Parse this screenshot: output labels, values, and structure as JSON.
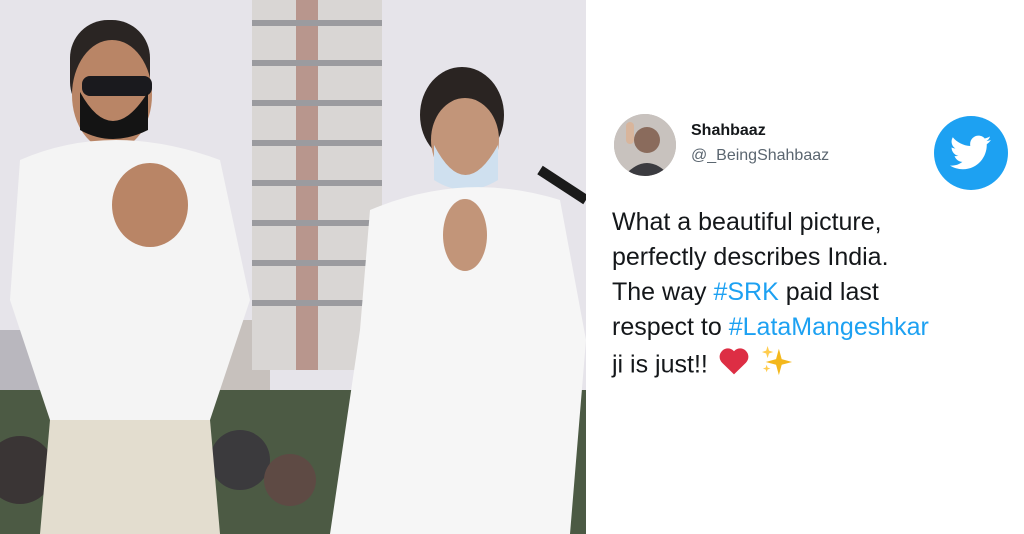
{
  "tweet": {
    "display_name": "Shahbaaz",
    "handle": "@_BeingShahbaaz",
    "text": {
      "line1": "What a beautiful picture,",
      "line2": "perfectly describes India.",
      "line3_prefix": "The way ",
      "line3_hashtag": "#SRK",
      "line3_suffix": " paid last",
      "line4_prefix": "respect to ",
      "line4_hashtag": "#LataMangeshkar",
      "line5": "ji is just!!"
    },
    "emojis": [
      "red-heart-emoji",
      "sparkles-emoji"
    ]
  },
  "colors": {
    "hashtag": "#1da1f2",
    "twitter_badge": "#1da1f2",
    "text": "#14171a",
    "handle": "#5b6670"
  },
  "icons": [
    "twitter-bird-icon"
  ]
}
